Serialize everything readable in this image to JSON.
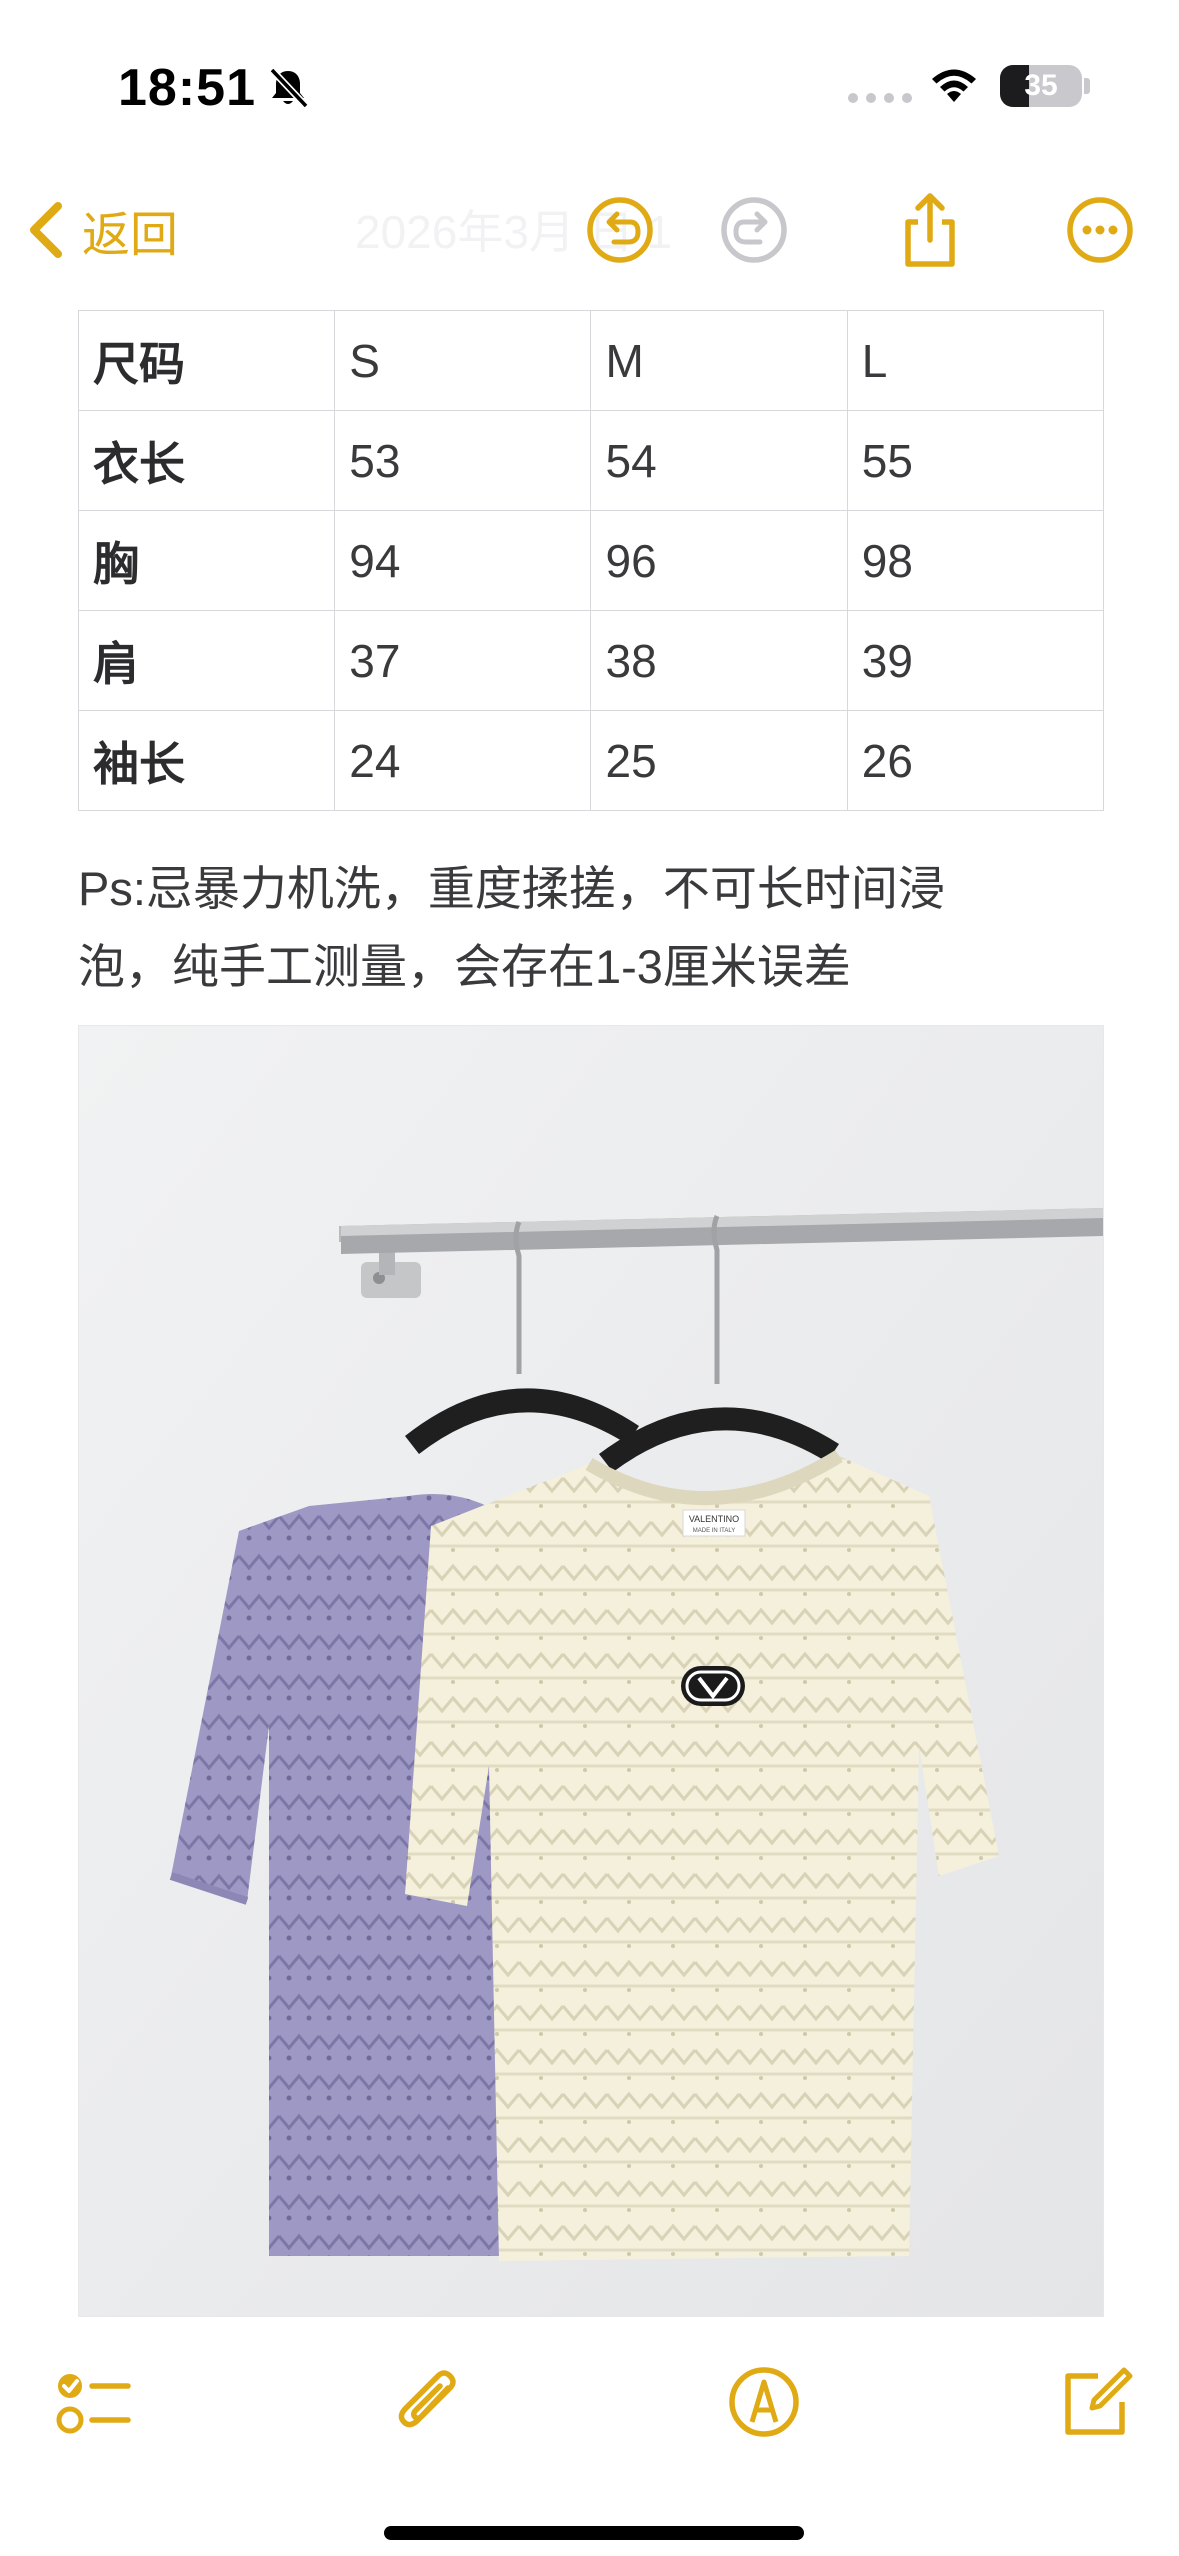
{
  "status_bar": {
    "time": "18:51",
    "battery_level": "35",
    "icons": [
      "bell-slash-icon",
      "cellular-dots-icon",
      "wifi-icon",
      "battery-icon"
    ]
  },
  "nav": {
    "back_label": "返回",
    "date_text": "2026年3月 日 1",
    "icons": [
      "chevron-left-icon",
      "undo-icon",
      "redo-icon",
      "share-icon",
      "more-icon"
    ]
  },
  "size_table": {
    "rows": [
      [
        "尺码",
        "S",
        "M",
        "L"
      ],
      [
        "衣长",
        "53",
        "54",
        "55"
      ],
      [
        "胸",
        "94",
        "96",
        "98"
      ],
      [
        "肩",
        "37",
        "38",
        "39"
      ],
      [
        "袖长",
        "24",
        "25",
        "26"
      ]
    ]
  },
  "note": {
    "line1": "Ps:忌暴力机洗，重度揉搓，不可长时间浸",
    "line2": "泡，纯手工测量，会存在1-3厘米误差"
  },
  "photo": {
    "label_text": "VALENTINO",
    "label_sub": "MADE IN ITALY"
  },
  "toolbar": {
    "icons": [
      "checklist-icon",
      "paperclip-icon",
      "markup-pen-icon",
      "compose-icon"
    ]
  },
  "colors": {
    "accent": "#e0aa14",
    "disabled": "#c7c7cc",
    "purple_shirt": "#9d98c2",
    "cream_shirt": "#f3efd9"
  }
}
